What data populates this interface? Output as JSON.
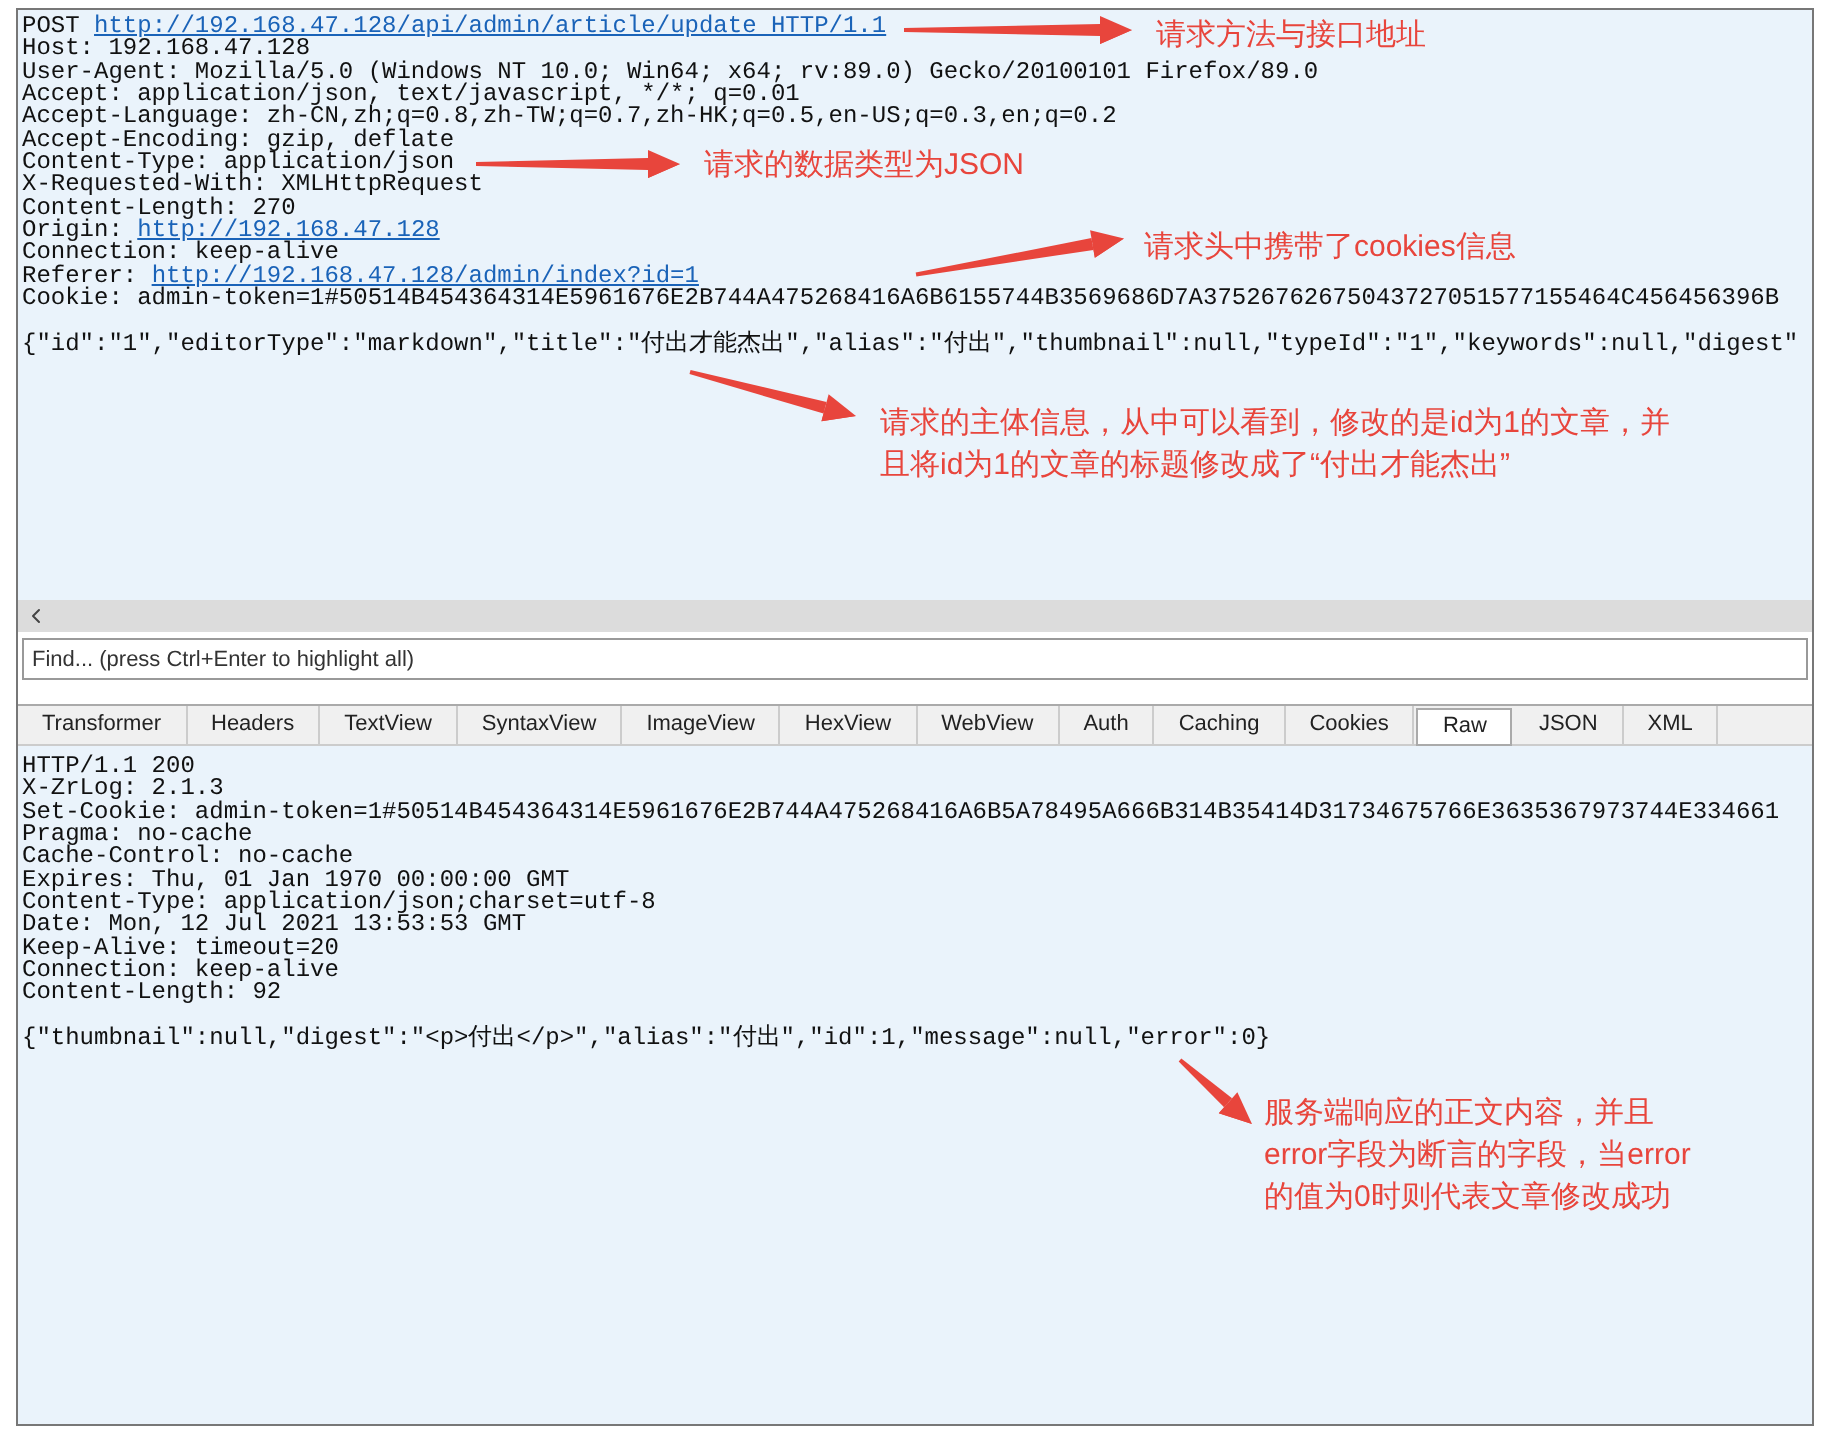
{
  "request": {
    "lines": [
      {
        "kind": "link",
        "label": "POST",
        "link": "http://192.168.47.128/api/admin/article/update HTTP/1.1"
      },
      {
        "kind": "text",
        "text": "Host: 192.168.47.128"
      },
      {
        "kind": "text",
        "text": "User-Agent: Mozilla/5.0 (Windows NT 10.0; Win64; x64; rv:89.0) Gecko/20100101 Firefox/89.0"
      },
      {
        "kind": "text",
        "text": "Accept: application/json, text/javascript, */*; q=0.01"
      },
      {
        "kind": "text",
        "text": "Accept-Language: zh-CN,zh;q=0.8,zh-TW;q=0.7,zh-HK;q=0.5,en-US;q=0.3,en;q=0.2"
      },
      {
        "kind": "text",
        "text": "Accept-Encoding: gzip, deflate"
      },
      {
        "kind": "text",
        "text": "Content-Type: application/json"
      },
      {
        "kind": "text",
        "text": "X-Requested-With: XMLHttpRequest"
      },
      {
        "kind": "text",
        "text": "Content-Length: 270"
      },
      {
        "kind": "link",
        "label": "Origin:",
        "link": "http://192.168.47.128"
      },
      {
        "kind": "text",
        "text": "Connection: keep-alive"
      },
      {
        "kind": "link",
        "label": "Referer:",
        "link": "http://192.168.47.128/admin/index?id=1"
      },
      {
        "kind": "text",
        "text": "Cookie: admin-token=1#50514B454364314E5961676E2B744A475268416A6B6155744B3569686D7A37526762675043727051577155464C456456396B"
      }
    ],
    "body": "{\"id\":\"1\",\"editorType\":\"markdown\",\"title\":\"付出才能杰出\",\"alias\":\"付出\",\"thumbnail\":null,\"typeId\":\"1\",\"keywords\":null,\"digest\""
  },
  "find": {
    "placeholder": "Find... (press Ctrl+Enter to highlight all)"
  },
  "tabs": [
    {
      "label": "Transformer",
      "selected": false
    },
    {
      "label": "Headers",
      "selected": false
    },
    {
      "label": "TextView",
      "selected": false
    },
    {
      "label": "SyntaxView",
      "selected": false
    },
    {
      "label": "ImageView",
      "selected": false
    },
    {
      "label": "HexView",
      "selected": false
    },
    {
      "label": "WebView",
      "selected": false
    },
    {
      "label": "Auth",
      "selected": false
    },
    {
      "label": "Caching",
      "selected": false
    },
    {
      "label": "Cookies",
      "selected": false
    },
    {
      "label": "Raw",
      "selected": true
    },
    {
      "label": "JSON",
      "selected": false
    },
    {
      "label": "XML",
      "selected": false
    }
  ],
  "response": {
    "lines": [
      "HTTP/1.1 200",
      "X-ZrLog: 2.1.3",
      "Set-Cookie: admin-token=1#50514B454364314E5961676E2B744A475268416A6B5A78495A666B314B35414D31734675766E3635367973744E334661",
      "Pragma: no-cache",
      "Cache-Control: no-cache",
      "Expires: Thu, 01 Jan 1970 00:00:00 GMT",
      "Content-Type: application/json;charset=utf-8",
      "Date: Mon, 12 Jul 2021 13:53:53 GMT",
      "Keep-Alive: timeout=20",
      "Connection: keep-alive",
      "Content-Length: 92"
    ],
    "body": "{\"thumbnail\":null,\"digest\":\"<p>付出</p>\",\"alias\":\"付出\",\"id\":1,\"message\":null,\"error\":0}"
  },
  "annotations": [
    {
      "lines": [
        "请求方法与接口地址"
      ]
    },
    {
      "lines": [
        "请求的数据类型为JSON"
      ]
    },
    {
      "lines": [
        "请求头中携带了cookies信息"
      ]
    },
    {
      "lines": [
        "请求的主体信息，从中可以看到，修改的是id为1的文章，并",
        "且将id为1的文章的标题修改成了“付出才能杰出”"
      ]
    },
    {
      "lines": [
        "服务端响应的正文内容，并且",
        "error字段为断言的字段，当error",
        "的值为0时则代表文章修改成功"
      ]
    }
  ]
}
